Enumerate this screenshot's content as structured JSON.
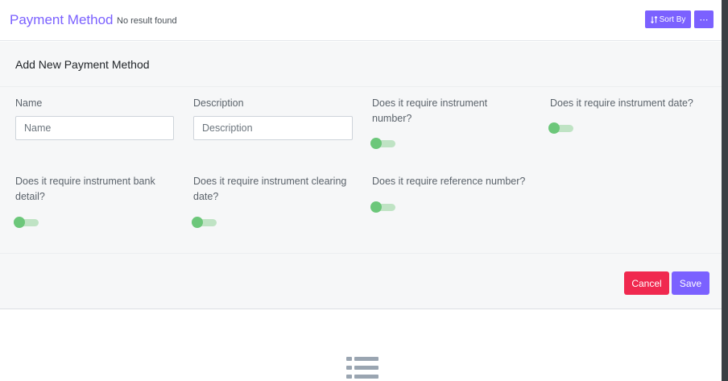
{
  "header": {
    "title": "Payment Method",
    "subtitle": "No result found",
    "sort_label": "Sort By",
    "more_label": "⋯"
  },
  "form": {
    "heading": "Add New Payment Method",
    "name": {
      "label": "Name",
      "placeholder": "Name",
      "value": ""
    },
    "description": {
      "label": "Description",
      "placeholder": "Description",
      "value": ""
    },
    "toggles": [
      {
        "label": "Does it require instrument number?",
        "enabled": false
      },
      {
        "label": "Does it require instrument date?",
        "enabled": false
      },
      {
        "label": "Does it require instrument bank detail?",
        "enabled": false
      },
      {
        "label": "Does it require instrument clearing date?",
        "enabled": false
      },
      {
        "label": "Does it require reference number?",
        "enabled": false
      }
    ],
    "cancel_label": "Cancel",
    "save_label": "Save"
  },
  "colors": {
    "accent": "#7b61ff",
    "danger": "#f0294f",
    "toggle": "#6cc77a"
  },
  "icons": {
    "sort": "sort-icon",
    "more": "more-icon",
    "empty": "list-icon"
  }
}
